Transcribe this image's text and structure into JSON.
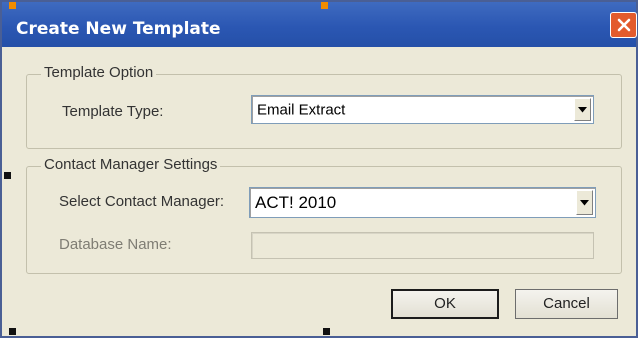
{
  "window": {
    "title": "Create New Template",
    "close_icon": "close-icon",
    "titlebar_color": "#2b57b3",
    "close_button_color": "#e35b2d",
    "background_color": "#ece9d8"
  },
  "template_option": {
    "legend": "Template Option",
    "template_type_label": "Template Type:",
    "template_type_value": "Email Extract"
  },
  "contact_manager_settings": {
    "legend": "Contact Manager Settings",
    "select_contact_manager_label": "Select Contact Manager:",
    "select_contact_manager_value": "ACT! 2010",
    "database_name_label": "Database Name:",
    "database_name_value": ""
  },
  "buttons": {
    "ok_label": "OK",
    "cancel_label": "Cancel"
  },
  "icons": {
    "dropdown_arrow": "chevron-down-icon"
  }
}
